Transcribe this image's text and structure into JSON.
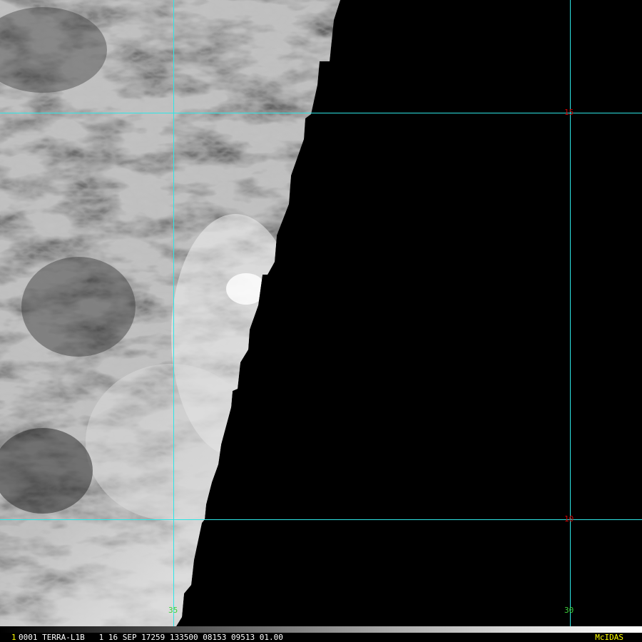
{
  "image": {
    "satellite": "TERRA",
    "product": "L1B",
    "description_colors": {
      "grid": "#2ee6e6",
      "lat_label": "#d40000",
      "lon_label": "#3cd23c",
      "status_text": "#ffffff",
      "status_accent": "#ffff00"
    }
  },
  "grid": {
    "latitudes": [
      {
        "label": "15"
      },
      {
        "label": "10"
      }
    ],
    "longitudes": [
      {
        "label": "35"
      },
      {
        "label": "30"
      }
    ]
  },
  "status": {
    "frame_number": "1",
    "text": "0001 TERRA-L1B   1 16 SEP 17259 133500 08153 09513 01.00",
    "software": "McIDAS"
  }
}
